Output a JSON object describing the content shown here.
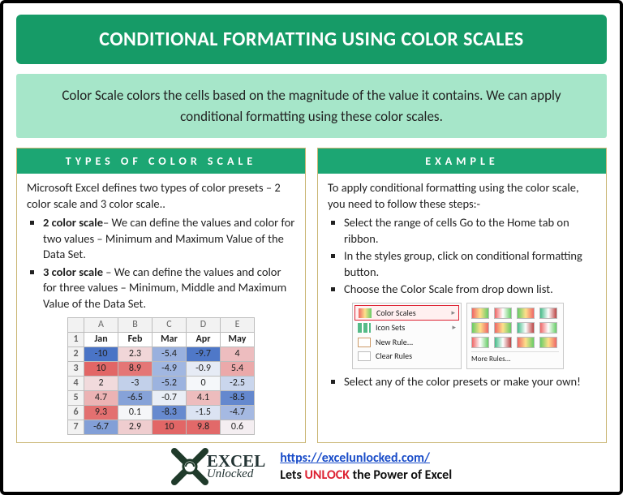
{
  "title": "CONDITIONAL FORMATTING USING COLOR SCALES",
  "intro": "Color Scale colors the cells based on the magnitude of the value it contains. We can apply conditional formatting using these color scales.",
  "left": {
    "heading": "TYPES OF COLOR SCALE",
    "para": "Microsoft Excel defines two types of color presets – 2 color scale and 3 color scale..",
    "bullets": [
      {
        "bold": "2 color scale",
        "text": "– We can define the values and color for two values – Minimum and Maximum Value of the Data Set."
      },
      {
        "bold": "3 color scale ",
        "text": "– We can define the values and color for three values – Minimum, Middle and Maximum Value of the Data Set."
      }
    ]
  },
  "right": {
    "heading": "EXAMPLE",
    "para": "To apply conditional formatting using the color scale, you need to follow these steps:-",
    "bullets_a": [
      "Select the range of cells Go to the Home tab on ribbon.",
      "In the styles group, click on conditional formatting button.",
      "Choose the Color Scale from drop down list."
    ],
    "bullets_b": [
      "Select any of the color presets or make your own!"
    ]
  },
  "menu": {
    "color_scales": "Color Scales",
    "icon_sets": "Icon Sets",
    "new_rule": "New Rule...",
    "clear_rules": "Clear Rules",
    "more_rules": "More Rules..."
  },
  "chart_data": {
    "type": "table",
    "columns": [
      "Jan",
      "Feb",
      "Mar",
      "Apr",
      "May"
    ],
    "rows": [
      [
        -10,
        2.3,
        -5.4,
        -9.7,
        4
      ],
      [
        10,
        8.9,
        -4.9,
        -0.9,
        5.4
      ],
      [
        2,
        -3,
        -5.2,
        0,
        -2.5
      ],
      [
        4.7,
        -6.5,
        -0.7,
        4.1,
        -8.5
      ],
      [
        9.3,
        0.1,
        -8.3,
        -1.5,
        -4.7
      ],
      [
        -6.7,
        2.9,
        10,
        9.8,
        0.6
      ]
    ],
    "scale": {
      "min": -10,
      "mid": 0,
      "max": 10,
      "low_color": "#4a74c6",
      "mid_color": "#f5f7fa",
      "high_color": "#e26666"
    }
  },
  "footer": {
    "brand1": "EXCEL",
    "brand2": "Unlocked",
    "url_text": "https://excelunlocked.com/",
    "url_href": "https://excelunlocked.com/",
    "tag_pre": "Lets ",
    "tag_bold": "UNLOCK",
    "tag_post": " the Power of Excel"
  }
}
